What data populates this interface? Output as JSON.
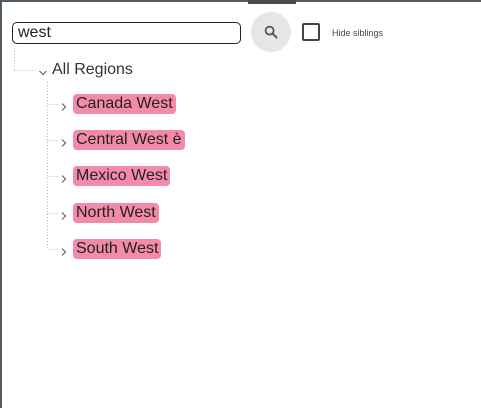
{
  "search": {
    "value": "west",
    "button_icon": "search-icon"
  },
  "hide_siblings": {
    "label": "Hide siblings",
    "checked": false
  },
  "tree": {
    "root": {
      "label": "All Regions",
      "expanded": true,
      "icon": "chevron-down-icon"
    },
    "items": [
      {
        "label": "Canada West",
        "icon": "chevron-right-icon"
      },
      {
        "label": "Central West è",
        "icon": "chevron-right-icon"
      },
      {
        "label": "Mexico West",
        "icon": "chevron-right-icon"
      },
      {
        "label": "North West",
        "icon": "chevron-right-icon"
      },
      {
        "label": "South West",
        "icon": "chevron-right-icon"
      }
    ],
    "highlight_color": "#f48aaa"
  }
}
